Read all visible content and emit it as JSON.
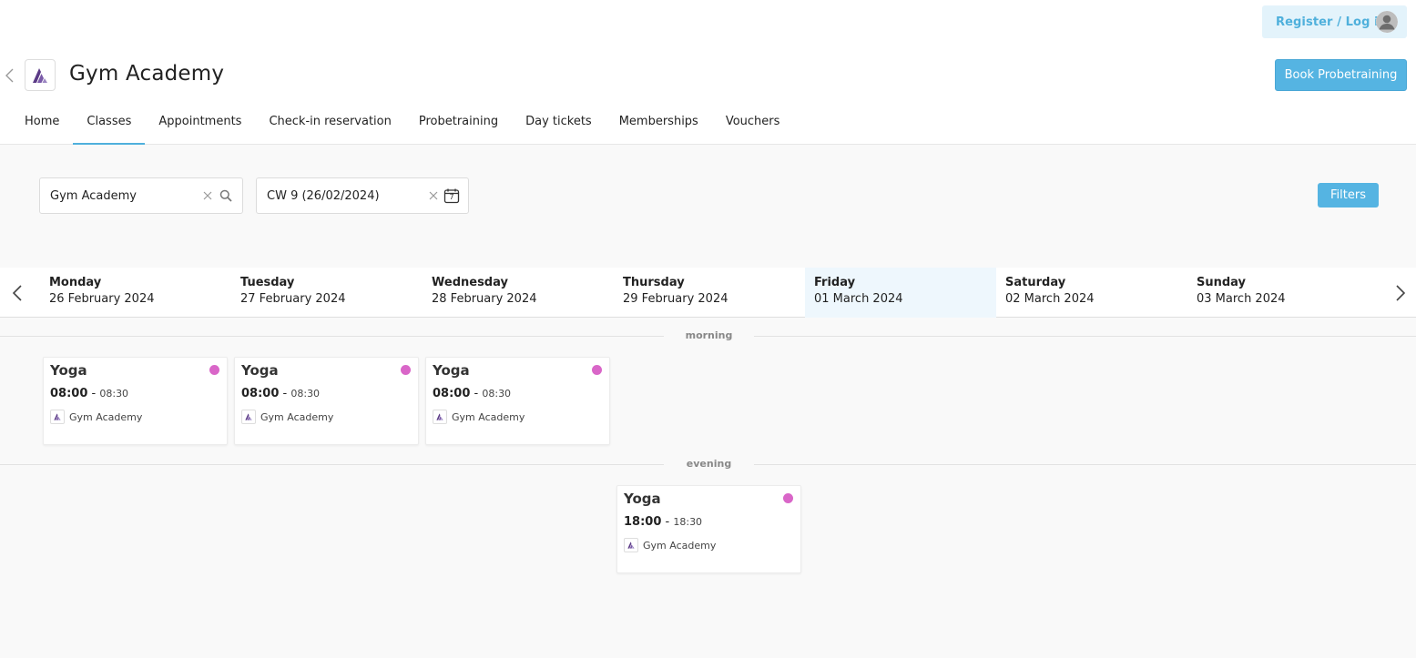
{
  "header": {
    "login_label": "Register / Log in",
    "gym_name": "Gym Academy",
    "book_label": "Book Probetraining"
  },
  "nav": {
    "items": [
      {
        "label": "Home",
        "active": false
      },
      {
        "label": "Classes",
        "active": true
      },
      {
        "label": "Appointments",
        "active": false
      },
      {
        "label": "Check-in reservation",
        "active": false
      },
      {
        "label": "Probetraining",
        "active": false
      },
      {
        "label": "Day tickets",
        "active": false
      },
      {
        "label": "Memberships",
        "active": false
      },
      {
        "label": "Vouchers",
        "active": false
      }
    ]
  },
  "filters": {
    "location_value": "Gym Academy",
    "week_value": "CW 9 (26/02/2024)",
    "calendar_day": "7",
    "filters_label": "Filters"
  },
  "days": [
    {
      "name": "Monday",
      "date": "26 February 2024"
    },
    {
      "name": "Tuesday",
      "date": "27 February 2024"
    },
    {
      "name": "Wednesday",
      "date": "28 February 2024"
    },
    {
      "name": "Thursday",
      "date": "29 February 2024"
    },
    {
      "name": "Friday",
      "date": "01 March 2024"
    },
    {
      "name": "Saturday",
      "date": "02 March 2024"
    },
    {
      "name": "Sunday",
      "date": "03 March 2024"
    }
  ],
  "today_index": 4,
  "sections": {
    "morning": "morning",
    "evening": "evening"
  },
  "classes": [
    {
      "name": "Yoga",
      "start": "08:00",
      "end": "08:30",
      "location": "Gym Academy",
      "day": 0,
      "section": "morning"
    },
    {
      "name": "Yoga",
      "start": "08:00",
      "end": "08:30",
      "location": "Gym Academy",
      "day": 1,
      "section": "morning"
    },
    {
      "name": "Yoga",
      "start": "08:00",
      "end": "08:30",
      "location": "Gym Academy",
      "day": 2,
      "section": "morning"
    },
    {
      "name": "Yoga",
      "start": "18:00",
      "end": "18:30",
      "location": "Gym Academy",
      "day": 3,
      "section": "evening"
    }
  ],
  "colors": {
    "accent": "#55b4e2",
    "class_dot": "#d966c8",
    "today_bg": "#eef7fd"
  }
}
